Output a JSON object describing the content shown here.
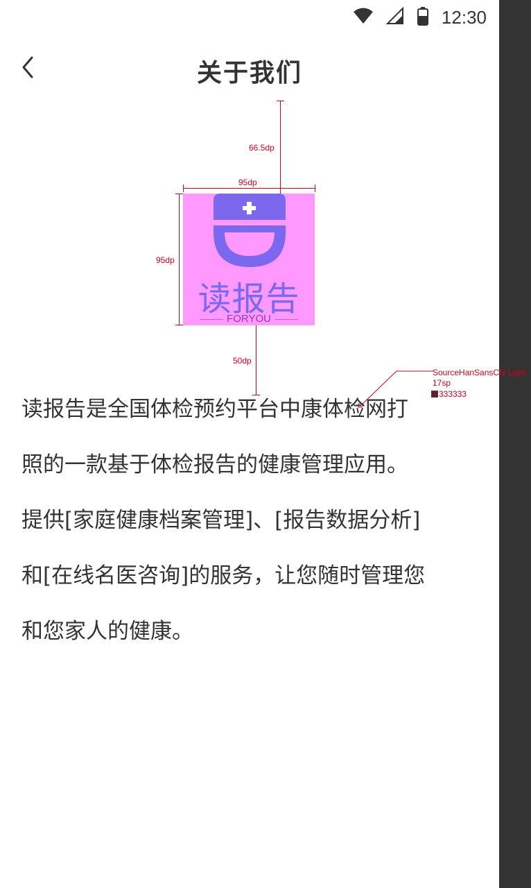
{
  "status_bar": {
    "time": "12:30",
    "icons": [
      "wifi-icon",
      "signal-icon",
      "battery-icon"
    ]
  },
  "header": {
    "title": "关于我们",
    "back_icon": "chevron-left-icon"
  },
  "logo": {
    "icon": "nurse-cap-icon",
    "text": "读报告",
    "subtext": "FORYOU"
  },
  "annotations": {
    "top_spacing": "66.5dp",
    "logo_width": "95dp",
    "logo_height": "95dp",
    "bottom_spacing": "50dp",
    "font_name": "SourceHanSansCN-Light",
    "font_size": "17sp",
    "font_color": "333333"
  },
  "content": {
    "lines": [
      "读报告是全国体检预约平台中康体检网打",
      "照的一款基于体检报告的健康管理应用。",
      "提供[家庭健康档案管理]、[报告数据分析]",
      "和[在线名医咨询]的服务，让您随时管理您",
      "和您家人的健康。"
    ]
  },
  "colors": {
    "text": "#333333",
    "logo_bg": "#ff99ff",
    "logo_purple": "#7b68ee",
    "annotation_red": "#d0021b",
    "side_strip": "#333333"
  }
}
